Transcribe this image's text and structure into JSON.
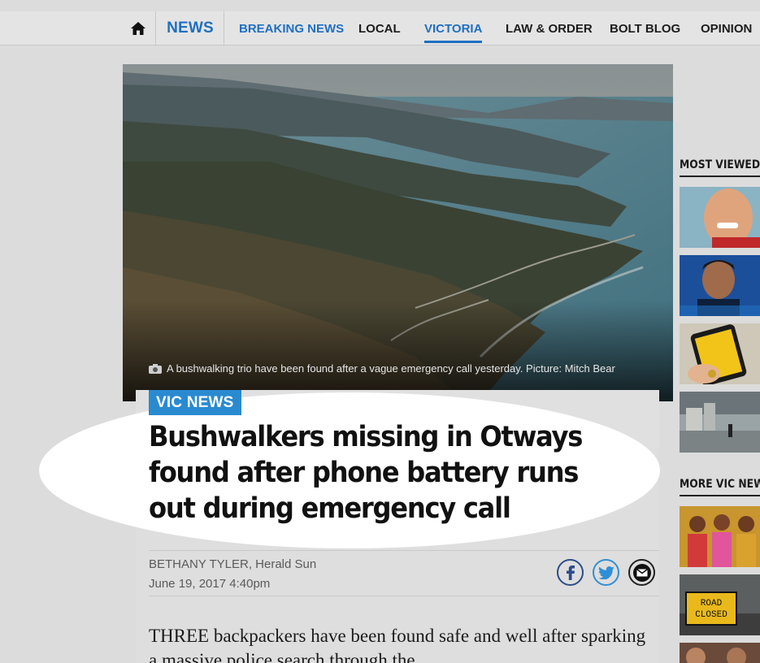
{
  "nav": {
    "brand": "NEWS",
    "items": [
      {
        "label": "BREAKING NEWS"
      },
      {
        "label": "LOCAL"
      },
      {
        "label": "VICTORIA"
      },
      {
        "label": "LAW & ORDER"
      },
      {
        "label": "BOLT BLOG"
      },
      {
        "label": "OPINION"
      }
    ],
    "home_icon": "home-icon",
    "active_item": "VICTORIA"
  },
  "hero": {
    "caption": "A bushwalking trio have been found after a vague emergency call yesterday. Picture: Mitch Bear",
    "caption_icon": "camera-icon"
  },
  "article": {
    "section_tag": "VIC NEWS",
    "headline": "Bushwalkers missing in Otways found after phone battery runs out during emergency call",
    "author": "BETHANY TYLER, Herald Sun",
    "date": "June 19, 2017 4:40pm",
    "body_start": "THREE backpackers have been found safe and well after sparking a massive police search through the",
    "share": [
      {
        "icon": "facebook-icon"
      },
      {
        "icon": "twitter-icon"
      },
      {
        "icon": "email-icon"
      }
    ]
  },
  "sidebar": {
    "most_viewed_heading": "MOST VIEWED",
    "more_heading": "MORE VIC NEWS",
    "thumb_sign_text": "ROAD CLOSED"
  },
  "colors": {
    "accent": "#1f6fc1",
    "tag": "#2a8ad0",
    "background": "#dcdcdc"
  }
}
